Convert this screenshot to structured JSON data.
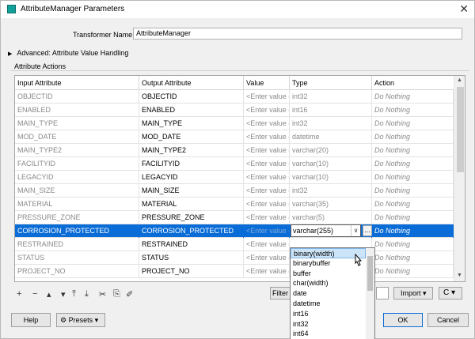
{
  "window": {
    "title": "AttributeManager Parameters",
    "close_icon": "close-icon"
  },
  "transformer": {
    "label": "Transformer Name:",
    "value": "AttributeManager"
  },
  "advanced": {
    "label": "Advanced: Attribute Value Handling"
  },
  "attribute_actions": {
    "label": "Attribute Actions"
  },
  "table": {
    "headers": [
      "Input Attribute",
      "Output Attribute",
      "Value",
      "Type",
      "Action"
    ],
    "rows": [
      [
        "OBJECTID",
        "OBJECTID",
        "<Enter value (o",
        "int32",
        "Do Nothing"
      ],
      [
        "ENABLED",
        "ENABLED",
        "<Enter value (o",
        "int16",
        "Do Nothing"
      ],
      [
        "MAIN_TYPE",
        "MAIN_TYPE",
        "<Enter value (o",
        "int32",
        "Do Nothing"
      ],
      [
        "MOD_DATE",
        "MOD_DATE",
        "<Enter value (o",
        "datetime",
        "Do Nothing"
      ],
      [
        "MAIN_TYPE2",
        "MAIN_TYPE2",
        "<Enter value (o",
        "varchar(20)",
        "Do Nothing"
      ],
      [
        "FACILITYID",
        "FACILITYID",
        "<Enter value (o",
        "varchar(10)",
        "Do Nothing"
      ],
      [
        "LEGACYID",
        "LEGACYID",
        "<Enter value (o",
        "varchar(10)",
        "Do Nothing"
      ],
      [
        "MAIN_SIZE",
        "MAIN_SIZE",
        "<Enter value (o",
        "int32",
        "Do Nothing"
      ],
      [
        "MATERIAL",
        "MATERIAL",
        "<Enter value (o",
        "varchar(35)",
        "Do Nothing"
      ],
      [
        "PRESSURE_ZONE",
        "PRESSURE_ZONE",
        "<Enter value (o",
        "varchar(5)",
        "Do Nothing"
      ],
      [
        "CORROSION_PROTECTED",
        "CORROSION_PROTECTED",
        "<Enter value (o",
        "varchar(255)",
        "Do Nothing"
      ],
      [
        "RESTRAINED",
        "RESTRAINED",
        "<Enter value (o",
        "",
        "Do Nothing"
      ],
      [
        "STATUS",
        "STATUS",
        "<Enter value (o",
        "",
        "Do Nothing"
      ],
      [
        "PROJECT_NO",
        "PROJECT_NO",
        "<Enter value (o",
        "",
        "Do Nothing"
      ]
    ],
    "selected_row": 10,
    "selected_type": "varchar(255)",
    "dots": "..."
  },
  "type_options": [
    "binary(width)",
    "binarybuffer",
    "buffer",
    "char(width)",
    "date",
    "datetime",
    "int16",
    "int32",
    "int64"
  ],
  "highlighted_option": 0,
  "toolbar": {
    "icons": [
      "+",
      "−",
      "▴",
      "▾",
      "⤒",
      "⤓",
      "✂",
      "⎘",
      "✐"
    ],
    "filter": "Filter",
    "import": "Import",
    "refresh": "C"
  },
  "footer": {
    "help": "Help",
    "presets": "Presets",
    "ok": "OK",
    "cancel": "Cancel"
  },
  "colors": {
    "selection": "#0a6cd6",
    "highlight": "#cce4f7"
  }
}
